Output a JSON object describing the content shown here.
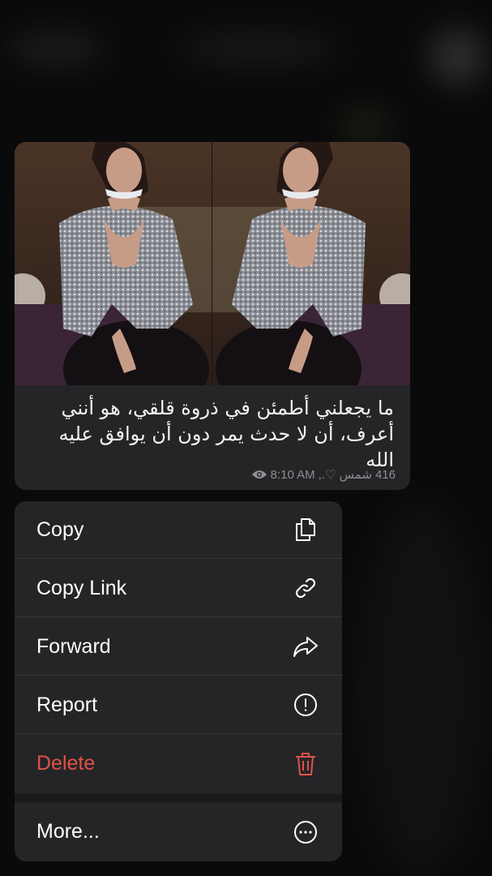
{
  "message": {
    "caption": "ما يجعلني أطمئن في ذروة قلقي، هو أنني أعرف، أن لا حدث يمر دون أن يوافق عليه الله",
    "views": "416",
    "author": "شمس ♡.,",
    "time": "8:10 AM"
  },
  "menu": {
    "items": [
      {
        "label": "Copy",
        "icon": "copy-icon"
      },
      {
        "label": "Copy Link",
        "icon": "link-icon"
      },
      {
        "label": "Forward",
        "icon": "forward-icon"
      },
      {
        "label": "Report",
        "icon": "report-icon"
      },
      {
        "label": "Delete",
        "icon": "trash-icon",
        "color": "#e0524a"
      },
      {
        "label": "More...",
        "icon": "more-icon"
      }
    ]
  },
  "colors": {
    "background": "#0a0a0b",
    "surface": "#252527",
    "danger": "#e0524a",
    "meta_text": "#8e8e93"
  }
}
